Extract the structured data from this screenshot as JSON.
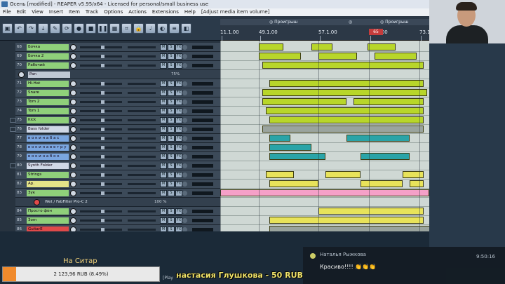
{
  "window": {
    "title": "Осень [modified] - REAPER v5.95/x64 - Licensed for personal/small business use"
  },
  "menu": {
    "items": [
      "File",
      "Edit",
      "View",
      "Insert",
      "Item",
      "Track",
      "Options",
      "Actions",
      "Extensions",
      "Help"
    ],
    "extra": "[Adjust media item volume]"
  },
  "toolbar": {
    "icons": [
      "save-icon",
      "undo-icon",
      "redo-icon",
      "download-icon",
      "wrench-icon",
      "loop-icon",
      "record-icon",
      "stop-icon",
      "pause-icon",
      "grid-icon",
      "snap-icon",
      "lock-icon",
      "metronome-icon",
      "headphones-icon",
      "mixer-icon",
      "envelope-icon"
    ]
  },
  "ruler": {
    "labels": [
      "11.1.00",
      "49.1.00",
      "57.1.00",
      "65.1.00",
      "73.1."
    ],
    "markers": [
      "Проигрыш",
      "",
      "Проигрыш"
    ],
    "playhead": "65"
  },
  "tracks": [
    {
      "num": "68",
      "name": "Бочка",
      "color": "#8fd07a"
    },
    {
      "num": "69",
      "name": "Бочка 2",
      "color": "#8fd07a"
    },
    {
      "num": "70",
      "name": "Рабочий",
      "color": "#8fd07a"
    },
    {
      "num": "71",
      "name": "Hi-Hat",
      "color": "#8fd07a"
    },
    {
      "num": "72",
      "name": "Snare",
      "color": "#8fd07a"
    },
    {
      "num": "73",
      "name": "Tom 2",
      "color": "#8fd07a"
    },
    {
      "num": "74",
      "name": "Tom 1",
      "color": "#8fd07a"
    },
    {
      "num": "75",
      "name": "Kick",
      "color": "#8fd07a"
    },
    {
      "num": "76",
      "name": "Bass folder",
      "color": "#d0d8e6"
    },
    {
      "num": "77",
      "name": "в о к и н а б а с",
      "color": "#7aa6e0"
    },
    {
      "num": "78",
      "name": "в о к и н а в е т р у",
      "color": "#7aa6e0"
    },
    {
      "num": "79",
      "name": "в о к и н а б о к",
      "color": "#7aa6e0"
    },
    {
      "num": "80",
      "name": "Synth Folder",
      "color": "#d0d8e6"
    },
    {
      "num": "81",
      "name": "Strings",
      "color": "#8fd07a"
    },
    {
      "num": "82",
      "name": "Ар.",
      "color": "#e3e388"
    },
    {
      "num": "83",
      "name": "Зук",
      "color": "#8fd07a"
    },
    {
      "num": "84",
      "name": "Просто фон",
      "color": "#8fd07a"
    },
    {
      "num": "85",
      "name": "Зоrn",
      "color": "#8fd07a"
    },
    {
      "num": "86",
      "name": "GuitarE",
      "color": "#e04a4a"
    },
    {
      "num": "87",
      "name": "",
      "color": "#3c4a59"
    }
  ],
  "pan_label": "Pan",
  "pan_value": "75%",
  "fx_chain": {
    "name": "Wet / FabFilter Pro-C 2",
    "value": "100 %"
  },
  "donation": {
    "title": "На Ситар",
    "amount": "2 123,96 RUB (8.49%)",
    "progress": 0.0849,
    "donor": "настасия Глушкова - 50 RUB",
    "hint": "[Play"
  },
  "chat": {
    "user": "Наталья Рыжкова",
    "time": "9:50:16",
    "message": "Красиво!!!! 👏👏👏"
  }
}
